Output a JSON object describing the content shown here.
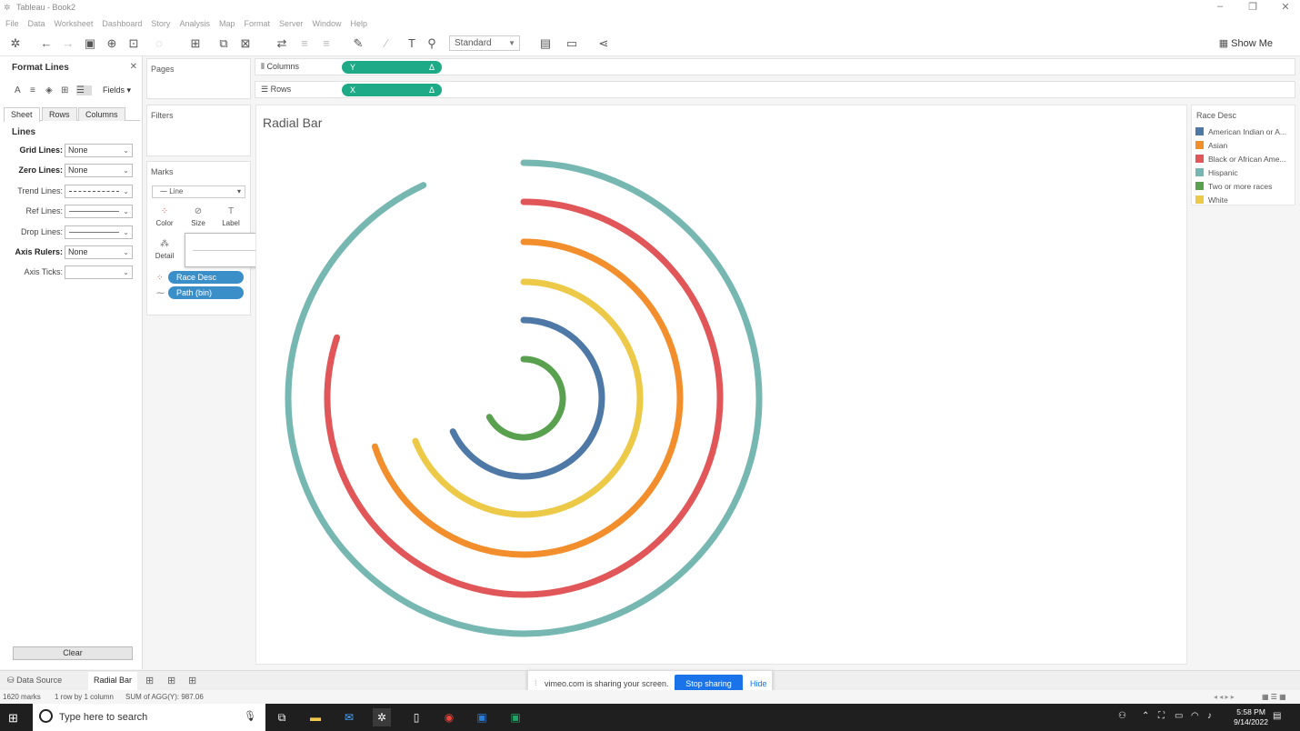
{
  "window": {
    "title": "Tableau - Book2"
  },
  "menu": [
    "File",
    "Data",
    "Worksheet",
    "Dashboard",
    "Story",
    "Analysis",
    "Map",
    "Format",
    "Server",
    "Window",
    "Help"
  ],
  "toolbar": {
    "fit_select": "Standard",
    "show_me": "Show Me"
  },
  "format_pane": {
    "title": "Format Lines",
    "fields_label": "Fields",
    "tabs": [
      "Sheet",
      "Rows",
      "Columns"
    ],
    "section": "Lines",
    "rows": [
      {
        "label": "Grid Lines:",
        "value": "None",
        "bold": true
      },
      {
        "label": "Zero Lines:",
        "value": "None",
        "bold": true
      },
      {
        "label": "Trend Lines:",
        "value": "",
        "bold": false
      },
      {
        "label": "Ref Lines:",
        "value": "",
        "bold": false
      },
      {
        "label": "Drop Lines:",
        "value": "",
        "bold": false
      },
      {
        "label": "Axis Rulers:",
        "value": "None",
        "bold": true
      },
      {
        "label": "Axis Ticks:",
        "value": "",
        "bold": false
      }
    ],
    "clear_button": "Clear"
  },
  "cards": {
    "pages": "Pages",
    "filters": "Filters",
    "marks": "Marks",
    "mark_type": "Line",
    "mark_buttons": [
      "Color",
      "Size",
      "Label",
      "Detail"
    ],
    "mark_pills": [
      "Race Desc",
      "Path (bin)"
    ],
    "size_slider_fraction": 0.83
  },
  "shelves": {
    "columns_label": "Columns",
    "columns_pill": "Y",
    "rows_label": "Rows",
    "rows_pill": "X"
  },
  "chart_data": {
    "type": "radial bar",
    "title": "Radial Bar",
    "legend_title": "Race Desc",
    "series": [
      {
        "name": "American Indian or A...",
        "color": "#4e79a7"
      },
      {
        "name": "Asian",
        "color": "#f28e2b"
      },
      {
        "name": "Black or African Ame...",
        "color": "#e15759"
      },
      {
        "name": "Hispanic",
        "color": "#76b7b2"
      },
      {
        "name": "Two or more races",
        "color": "#59a14f"
      },
      {
        "name": "White",
        "color": "#edc948"
      }
    ],
    "rings": [
      {
        "series": "Hispanic",
        "sweep_fraction": 0.93
      },
      {
        "series": "Black or African Ame...",
        "sweep_fraction": 0.8
      },
      {
        "series": "Asian",
        "sweep_fraction": 0.7
      },
      {
        "series": "White",
        "sweep_fraction": 0.69
      },
      {
        "series": "American Indian or A...",
        "sweep_fraction": 0.68
      },
      {
        "series": "Two or more races",
        "sweep_fraction": 0.67
      }
    ]
  },
  "sheet_tabs": {
    "data_source": "Data Source",
    "active_sheet": "Radial Bar"
  },
  "share_bar": {
    "message": "vimeo.com is sharing your screen.",
    "stop": "Stop sharing",
    "hide": "Hide"
  },
  "status": {
    "marks": "1620 marks",
    "layout": "1 row by 1 column",
    "sum": "SUM of AGG(Y): 987.06"
  },
  "taskbar": {
    "search_placeholder": "Type here to search",
    "time": "5:58 PM",
    "date": "9/14/2022"
  }
}
